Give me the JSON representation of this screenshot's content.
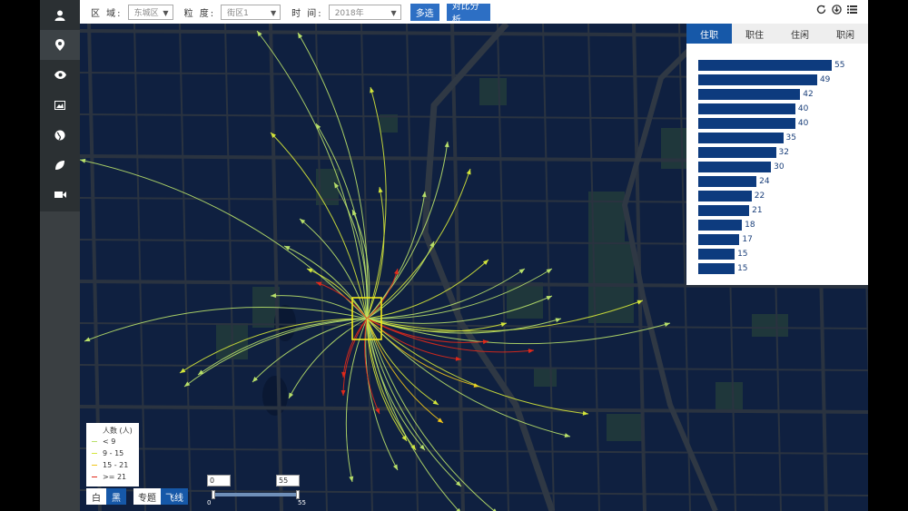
{
  "sidebar": {
    "items": [
      {
        "icon": "user-icon"
      },
      {
        "icon": "map-pin-icon"
      },
      {
        "icon": "eye-icon"
      },
      {
        "icon": "image-icon"
      },
      {
        "icon": "globe-icon"
      },
      {
        "icon": "leaf-icon"
      },
      {
        "icon": "video-icon"
      }
    ]
  },
  "toolbar": {
    "region_label": "区  域:",
    "region_value": "东城区",
    "granularity_label": "粒  度:",
    "granularity_value": "街区1",
    "time_label": "时  间:",
    "time_value": "2018年",
    "multi_select_label": "多选",
    "compare_label": "对比分析",
    "icons": [
      "refresh-icon",
      "download-icon",
      "list-icon"
    ]
  },
  "panel": {
    "tabs": [
      "住职",
      "职住",
      "住闲",
      "职闲"
    ],
    "active_tab": 0,
    "bar_color": "#0d3b7e",
    "values": [
      55,
      49,
      42,
      40,
      40,
      35,
      32,
      30,
      24,
      22,
      21,
      18,
      17,
      15,
      15
    ]
  },
  "legend": {
    "title": "人数 (人)",
    "items": [
      {
        "label": "< 9",
        "color": "#b8e06a"
      },
      {
        "label": "9 - 15",
        "color": "#d4e63a"
      },
      {
        "label": "15 - 21",
        "color": "#f0c419"
      },
      {
        "label": ">= 21",
        "color": "#e0291a"
      }
    ]
  },
  "mode": {
    "white_label": "白",
    "black_label": "黑",
    "thematic_label": "专题",
    "flyline_label": "飞线"
  },
  "range": {
    "min": "0",
    "max": "55",
    "min_tick": "0",
    "max_tick": "55"
  }
}
